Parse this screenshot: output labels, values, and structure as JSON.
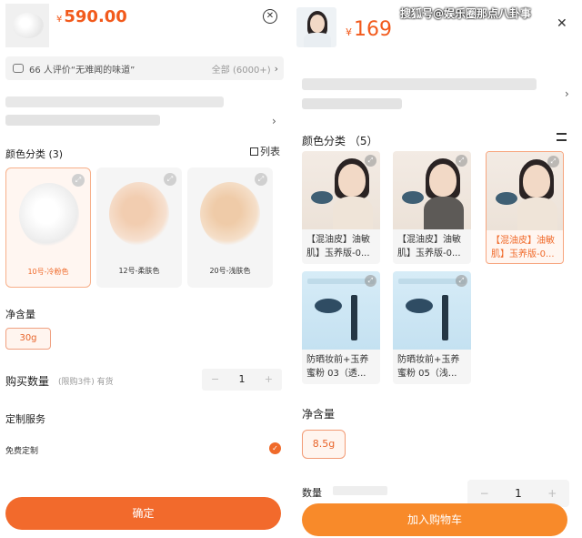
{
  "left": {
    "price": {
      "currency": "¥",
      "amount": "590.00"
    },
    "review": {
      "text": "66 人评价“无难闻的味道”",
      "all": "全部 (6000+)"
    },
    "color_section": {
      "title": "颜色分类 (3)",
      "list_view": "列表"
    },
    "shades": [
      {
        "label": "10号-冷粉色",
        "selected": true,
        "color": "#f4f4f4"
      },
      {
        "label": "12号-柔肤色",
        "selected": false,
        "color": "#f2cdb0"
      },
      {
        "label": "20号-浅肤色",
        "selected": false,
        "color": "#efcba8"
      }
    ],
    "size_section": {
      "title": "净含量",
      "option": "30g"
    },
    "quantity": {
      "title": "购买数量",
      "hint": "(限购3件) 有货",
      "minus": "−",
      "value": "1",
      "plus": "+"
    },
    "custom_service": {
      "title": "定制服务",
      "option": "免费定制",
      "check": "✓"
    },
    "confirm_button": "确定",
    "accent_color": "#f26a2c"
  },
  "right": {
    "price": {
      "currency": "¥",
      "amount": "169"
    },
    "watermark": "搜狐号@娱乐圈那点八卦事",
    "color_section": {
      "title": "颜色分类 （5）"
    },
    "variants": [
      {
        "label": "【混油皮】油敏肌】玉养版-0...",
        "style": "warm",
        "selected": false
      },
      {
        "label": "【混油皮】油敏肌】玉养版-0...",
        "style": "warm",
        "selected": false
      },
      {
        "label": "【混油皮】油敏肌】玉养版-0...",
        "style": "warm",
        "selected": true
      },
      {
        "label": "防晒妆前+玉养蜜粉 03（透...",
        "style": "cool",
        "selected": false
      },
      {
        "label": "防晒妆前+玉养蜜粉 05（浅...",
        "style": "cool",
        "selected": false
      }
    ],
    "size_section": {
      "title": "净含量",
      "option": "8.5g"
    },
    "quantity": {
      "title": "数量",
      "minus": "−",
      "value": "1",
      "plus": "+"
    },
    "cart_button": "加入购物车",
    "accent_color": "#f88a2a"
  }
}
